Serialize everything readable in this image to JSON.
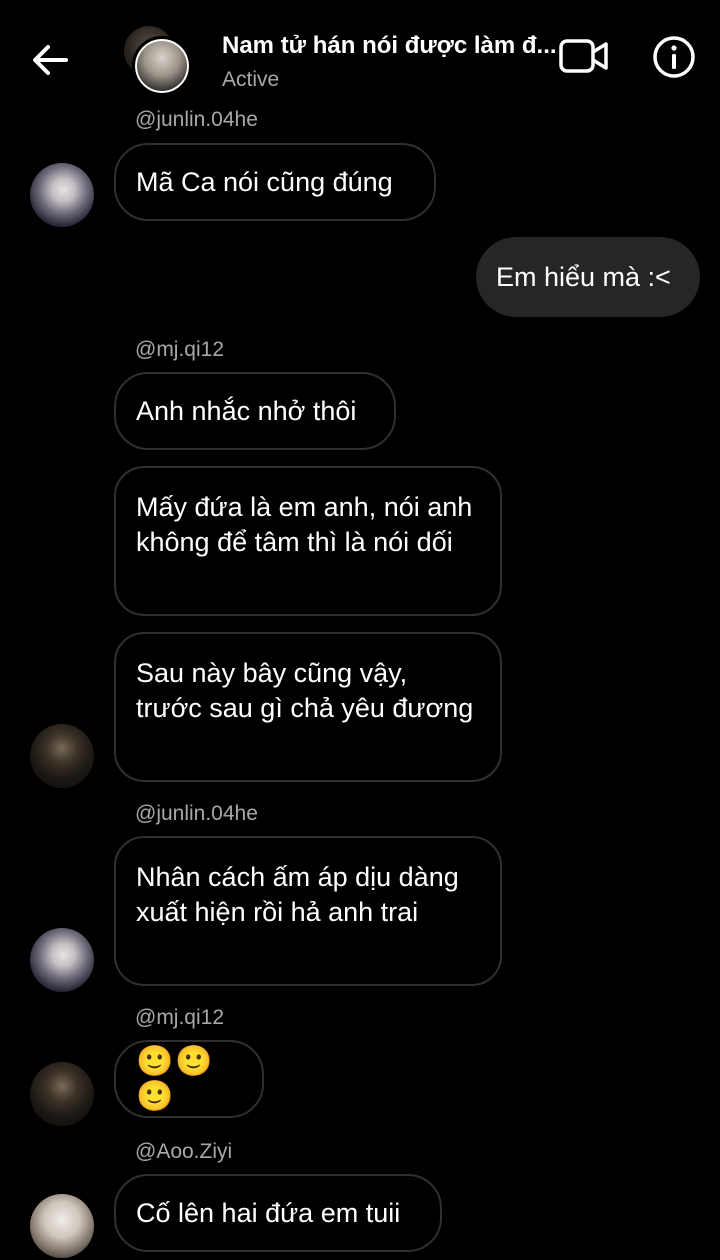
{
  "header": {
    "title": "Nam tử hán nói được làm đ...",
    "status": "Active"
  },
  "messages": [
    {
      "username": "@junlin.04he",
      "text": "Mã Ca nói cũng đúng"
    },
    {
      "text": "Em hiểu mà :<",
      "outgoing": true
    },
    {
      "username": "@mj.qi12",
      "texts": [
        "Anh nhắc nhở thôi",
        "Mấy đứa là em anh, nói anh không để tâm thì là nói dối",
        "Sau này bây cũng vậy, trước sau gì chả yêu đương"
      ]
    },
    {
      "username": "@junlin.04he",
      "text": "Nhân cách ấm áp dịu dàng xuất hiện rồi hả anh trai"
    },
    {
      "username": "@mj.qi12",
      "text": "🙂🙂🙂"
    },
    {
      "username": "@Aoo.Ziyi",
      "text": "Cố lên hai đứa em tuii"
    }
  ],
  "colors": {
    "background": "#000000",
    "bubble_border": "#303030",
    "outgoing_bubble": "#262626",
    "secondary_text": "#a8a8a8"
  },
  "icons": [
    "back-arrow-icon",
    "video-call-icon",
    "info-icon"
  ]
}
